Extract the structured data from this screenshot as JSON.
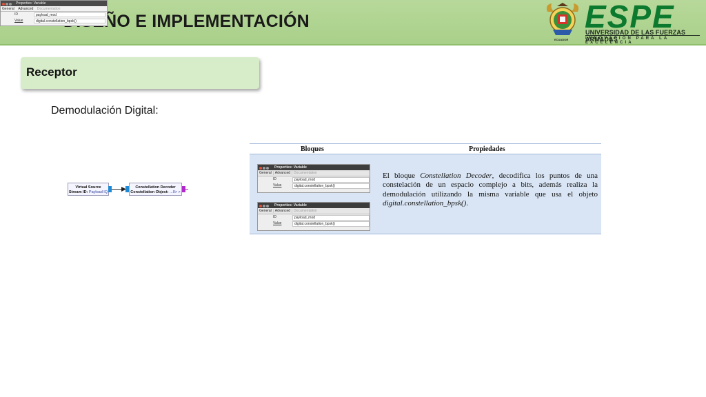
{
  "header": {
    "title": "DISEÑO E IMPLEMENTACIÓN",
    "logo": {
      "wordmark": "ESPE",
      "subtitle": "UNIVERSIDAD DE LAS FUERZAS ARMADAS",
      "tagline": "INNOVACIÓN PARA LA EXCELENCIA",
      "seal_label": "ECUADOR",
      "brand_color": "#0c7a2e"
    }
  },
  "section": {
    "title": "Receptor",
    "subtitle": "Demodulación Digital:"
  },
  "flowgraph": {
    "source_block": {
      "title": "Virtual Source",
      "param_key": "Stream ID:",
      "param_value": "Payload IQ"
    },
    "decoder_block": {
      "title": "Constellation Decoder",
      "param_key": "Constellation Object:",
      "param_value": "...0> >"
    }
  },
  "properties_window": {
    "title": "Properties: Variable",
    "tabs": [
      "General",
      "Advanced",
      "Documentation"
    ],
    "rows": [
      {
        "key": "ID",
        "value": "payload_mod"
      },
      {
        "key": "Value",
        "value": "digital.constellation_bpsk()"
      }
    ]
  },
  "table": {
    "headers": [
      "Bloques",
      "Propiedades"
    ],
    "description": {
      "p1": "El bloque ",
      "p2": "Constellation Decoder",
      "p3": ", decodifica los puntos de una constelación de un espacio complejo a bits, además realiza la demodulación utilizando la misma variable que usa el objeto ",
      "p4": "digital.constellation_bpsk()",
      "p5": "."
    }
  }
}
